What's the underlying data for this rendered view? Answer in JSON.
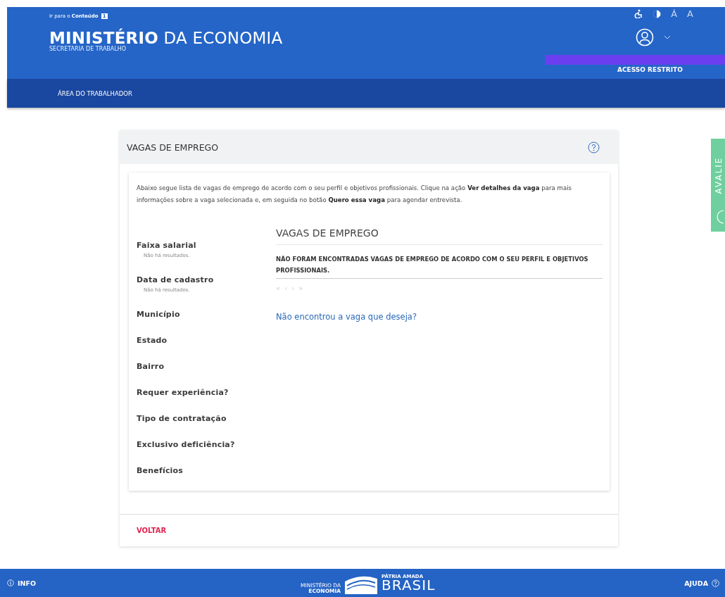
{
  "header": {
    "skip_link": "Ir para o",
    "skip_link_bold": "Conteúdo",
    "skip_key": "1",
    "title_bold": "MINISTÉRIO",
    "title_rest": "DA ECONOMIA",
    "subtitle": "SECRETARIA DE TRABALHO",
    "font_small": "Ȧ",
    "font_large": "A",
    "restricted": "ACESSO RESTRITO"
  },
  "nav": {
    "items": [
      {
        "label": "ÁREA DO TRABALHADOR"
      }
    ]
  },
  "card": {
    "title": "VAGAS DE EMPREGO",
    "intro": "Abaixo segue lista de vagas de emprego de acordo com o seu perfil e objetivos profissionais. Clique na ação **Ver detalhes da vaga** para mais informações sobre a vaga selecionada e, em seguida no botão **Quero essa vaga** para agendar entrevista.",
    "filters": [
      {
        "label": "Faixa salarial",
        "note": "Não há resultados."
      },
      {
        "label": "Data de cadastro",
        "note": "Não há resultados."
      },
      {
        "label": "Município"
      },
      {
        "label": "Estado"
      },
      {
        "label": "Bairro"
      },
      {
        "label": "Requer experiência?"
      },
      {
        "label": "Tipo de contratação"
      },
      {
        "label": "Exclusivo deficiência?"
      },
      {
        "label": "Benefícios"
      }
    ],
    "results_title": "VAGAS DE EMPREGO",
    "empty_message": "NÃO FORAM ENCONTRADAS VAGAS DE EMPREGO DE ACORDO COM O SEU PERFIL E OBJETIVOS PROFISSIONAIS.",
    "pager": [
      {
        "label": "«",
        "disabled": true
      },
      {
        "label": "‹",
        "disabled": true
      },
      {
        "label": "›",
        "disabled": true
      },
      {
        "label": "»",
        "disabled": true
      }
    ],
    "not_found_link": "Não encontrou a vaga que deseja?",
    "back": "VOLTAR"
  },
  "feedback_tab": "AVALIE",
  "footer": {
    "info": "INFO",
    "logo_ministry_1": "MINISTÉRIO DA",
    "logo_ministry_2": "ECONOMIA",
    "logo_motto": "PÁTRIA AMADA",
    "logo_country": "BRASIL",
    "help": "AJUDA"
  }
}
